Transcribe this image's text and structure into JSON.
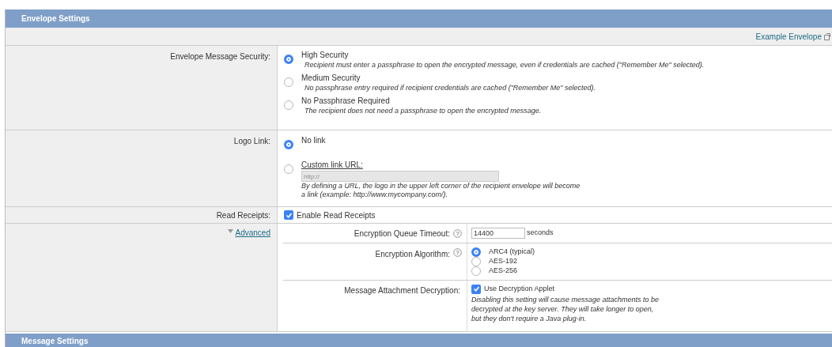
{
  "section": {
    "title": "Envelope Settings"
  },
  "example_link": "Example Envelope",
  "security": {
    "label": "Envelope Message Security:",
    "options": [
      {
        "label": "High Security",
        "description": "Recipient must enter a passphrase to open the encrypted message, even if credentials are cached (\"Remember Me\" selected).",
        "selected": true
      },
      {
        "label": "Medium Security",
        "description": "No passphrase entry required if recipient credentials are cached (\"Remember Me\" selected).",
        "selected": false
      },
      {
        "label": "No Passphrase Required",
        "description": "The recipient does not need a passphrase to open the encrypted message.",
        "selected": false
      }
    ]
  },
  "logo_link": {
    "label": "Logo Link:",
    "options": [
      {
        "label": "No link",
        "selected": true
      },
      {
        "label": "Custom link URL:",
        "selected": false
      }
    ],
    "url_placeholder": "http://",
    "note_lines": [
      "By defining a URL, the logo in the upper left corner of the recipient envelope will become",
      "a link (example: http://www.mycompany.com/)."
    ]
  },
  "read_receipts": {
    "label": "Read Receipts:",
    "checkbox": {
      "label": "Enable Read Receipts",
      "checked": true
    }
  },
  "advanced": {
    "label": "Advanced",
    "expanded": true,
    "timeout": {
      "label": "Encryption Queue Timeout:",
      "help": "?",
      "value": "14400",
      "unit": "seconds"
    },
    "algorithm": {
      "label": "Encryption Algorithm:",
      "help": "?",
      "options": [
        {
          "label": "ARC4 (typical)",
          "selected": true
        },
        {
          "label": "AES-192",
          "selected": false
        },
        {
          "label": "AES-256",
          "selected": false
        }
      ]
    },
    "decryption": {
      "label": "Message Attachment Decryption:",
      "checkbox": {
        "label": "Use Decryption Applet",
        "checked": true
      },
      "note_lines": [
        "Disabling this setting will cause message attachments to be",
        "decrypted at the key server. They will take longer to open,",
        "but they don't require a Java plug-in."
      ]
    }
  },
  "next_section": {
    "title": "Message Settings"
  }
}
